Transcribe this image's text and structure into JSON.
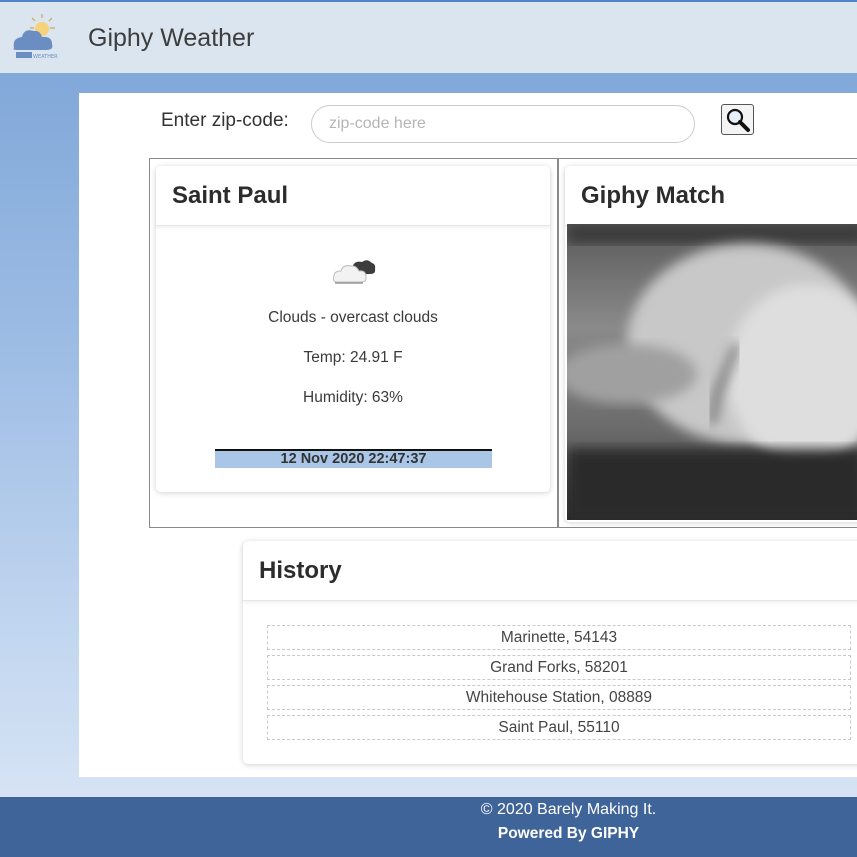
{
  "app": {
    "title": "Giphy Weather",
    "logo_text": "WEATHER",
    "accent_color": "#3f6499",
    "navbar_color": "#dbe5f0"
  },
  "search": {
    "label": "Enter zip-code:",
    "placeholder": "zip-code here",
    "value": "",
    "button_icon": "magnifier-icon"
  },
  "weather": {
    "city": "Saint Paul",
    "icon": "cloud-icon",
    "description": "Clouds - overcast clouds",
    "temp": "Temp: 24.91 F",
    "humidity": "Humidity: 63%",
    "datetime": "12 Nov 2020 22:47:37"
  },
  "giphy": {
    "title": "Giphy Match"
  },
  "history": {
    "title": "History",
    "items": [
      "Marinette, 54143",
      "Grand Forks, 58201",
      "Whitehouse Station, 08889",
      "Saint Paul, 55110"
    ]
  },
  "footer": {
    "copyright": "© 2020 Barely Making It.",
    "powered": "Powered By GIPHY"
  }
}
